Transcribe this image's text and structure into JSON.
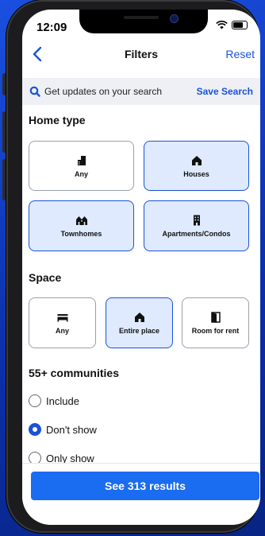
{
  "status_bar": {
    "time": "12:09"
  },
  "header": {
    "title": "Filters",
    "reset_label": "Reset"
  },
  "banner": {
    "text": "Get updates on your search",
    "action_label": "Save Search"
  },
  "home_type": {
    "title": "Home type",
    "options": [
      {
        "label": "Any",
        "icon": "building-icon",
        "selected": false
      },
      {
        "label": "Houses",
        "icon": "house-icon",
        "selected": true
      },
      {
        "label": "Townhomes",
        "icon": "townhome-icon",
        "selected": true
      },
      {
        "label": "Apartments/Condos",
        "icon": "apartment-icon",
        "selected": true
      }
    ]
  },
  "space": {
    "title": "Space",
    "options": [
      {
        "label": "Any",
        "icon": "bed-icon",
        "selected": false
      },
      {
        "label": "Entire place",
        "icon": "house-icon",
        "selected": true
      },
      {
        "label": "Room for rent",
        "icon": "door-icon",
        "selected": false
      }
    ]
  },
  "communities": {
    "title": "55+ communities",
    "options": [
      {
        "label": "Include",
        "checked": false
      },
      {
        "label": "Don't show",
        "checked": true
      },
      {
        "label": "Only show",
        "checked": false
      }
    ]
  },
  "footer": {
    "results_label": "See 313 results"
  },
  "colors": {
    "accent": "#1a52d8",
    "button": "#1a6cf0",
    "selected_bg": "#dfeaff"
  }
}
